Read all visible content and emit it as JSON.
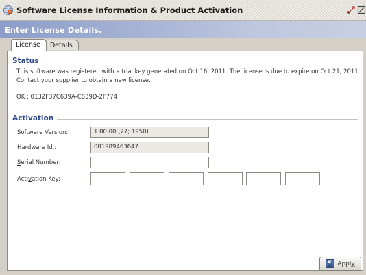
{
  "window": {
    "title": "Software License Information & Product Activation"
  },
  "header": {
    "title": "Enter License Details."
  },
  "tabs": [
    {
      "label": "License",
      "active": true
    },
    {
      "label": "Details",
      "active": false
    }
  ],
  "status": {
    "title": "Status",
    "line1": "This software was registered with a trial key generated on Oct 16, 2011. The license is due to expire on Oct 21, 2011.",
    "line2": "Contact your supplier to obtain a new license.",
    "code": "OK : 0132F37C639A-C839D-2F774"
  },
  "activation": {
    "title": "Activation",
    "software_version_label": "Software Version:",
    "software_version_value": "1.00.00 (27; 1950)",
    "hardware_id_label": "Hardware Id.:",
    "hardware_id_value": "001989463647",
    "serial_label_pre": "",
    "serial_label_mnemonic": "S",
    "serial_label_post": "erial Number:",
    "serial_value": "",
    "key_label_pre": "Acti",
    "key_label_mnemonic": "v",
    "key_label_post": "ation Key:",
    "key_values": [
      "",
      "",
      "",
      "",
      "",
      ""
    ]
  },
  "footer": {
    "apply_pre": "Appl",
    "apply_mnemonic": "y",
    "apply_post": ""
  },
  "icons": {
    "app": "gear-globe-icon",
    "restore": "restore-icon",
    "close": "close-icon",
    "apply": "save-disk-icon"
  }
}
